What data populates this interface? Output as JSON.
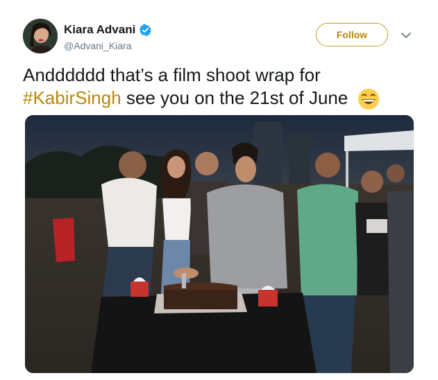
{
  "user": {
    "display_name": "Kiara Advani",
    "handle": "@Advani_Kiara",
    "verified": true
  },
  "actions": {
    "follow_label": "Follow"
  },
  "tweet": {
    "text_part1": "Andddddd that’s a film shoot wrap for",
    "hashtag": "#KabirSingh",
    "text_part2": " see you on the 21st of June"
  },
  "icons": {
    "verified": "verified-badge-icon",
    "caret": "chevron-down-icon",
    "emoji": "grinning-face-emoji"
  },
  "colors": {
    "accent": "#b8860b",
    "verified": "#1da1f2",
    "text": "#14171a",
    "muted": "#657786"
  }
}
